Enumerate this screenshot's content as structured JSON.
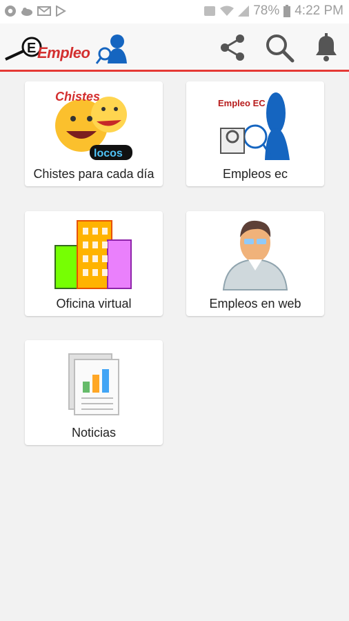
{
  "status_bar": {
    "battery": "78%",
    "time": "4:22 PM"
  },
  "app_bar": {
    "logo_text": "Empleo",
    "icons": [
      "share-icon",
      "search-icon",
      "bell-icon"
    ]
  },
  "cards": [
    {
      "label": "Chistes para cada día",
      "image_text": [
        "Chistes",
        "locos"
      ]
    },
    {
      "label": "Empleos ec",
      "image_text": [
        "Empleo EC"
      ]
    },
    {
      "label": "Oficina virtual"
    },
    {
      "label": "Empleos en web"
    },
    {
      "label": "Noticias"
    }
  ],
  "colors": {
    "accent": "#e53935",
    "background": "#f2f2f2",
    "card": "#ffffff"
  }
}
